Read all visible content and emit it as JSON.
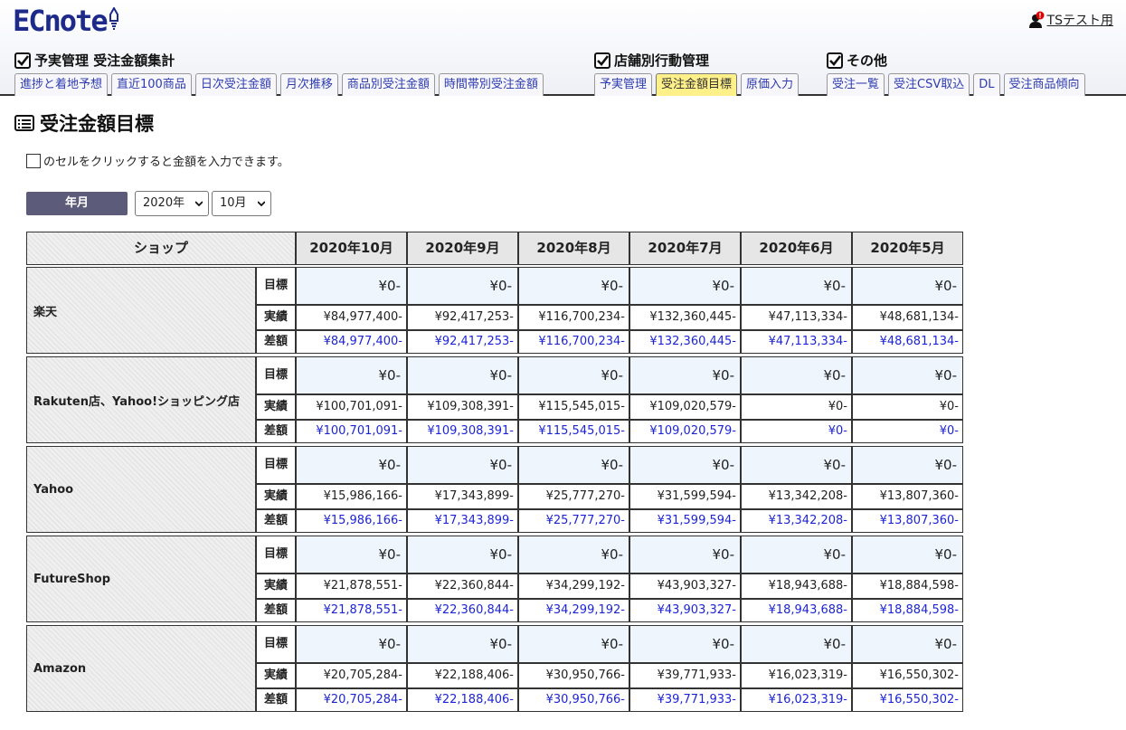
{
  "app": {
    "logo": "ECnote",
    "user": "TSテスト用"
  },
  "nav": {
    "sections": [
      {
        "title": "予実管理 受注金額集計",
        "tabs": [
          "進捗と着地予想",
          "直近100商品",
          "日次受注金額",
          "月次推移",
          "商品別受注金額",
          "時間帯別受注金額"
        ]
      },
      {
        "title": "店舗別行動管理",
        "tabs": [
          "予実管理",
          "受注金額目標",
          "原価入力"
        ],
        "active": "受注金額目標"
      },
      {
        "title": "その他",
        "tabs": [
          "受注一覧",
          "受注CSV取込",
          "DL",
          "受注商品傾向"
        ]
      }
    ]
  },
  "page": {
    "title": "受注金額目標",
    "hint": "のセルをクリックすると金額を入力できます。",
    "ym_label": "年月",
    "year_value": "2020年",
    "month_value": "10月"
  },
  "table": {
    "shop_header": "ショップ",
    "months": [
      "2020年10月",
      "2020年9月",
      "2020年8月",
      "2020年7月",
      "2020年6月",
      "2020年5月"
    ],
    "row_labels": {
      "target": "目標",
      "actual": "実績",
      "diff": "差額"
    },
    "shops": [
      {
        "name": "楽天",
        "target": [
          "¥0-",
          "¥0-",
          "¥0-",
          "¥0-",
          "¥0-",
          "¥0-"
        ],
        "actual": [
          "¥84,977,400-",
          "¥92,417,253-",
          "¥116,700,234-",
          "¥132,360,445-",
          "¥47,113,334-",
          "¥48,681,134-"
        ],
        "diff": [
          "¥84,977,400-",
          "¥92,417,253-",
          "¥116,700,234-",
          "¥132,360,445-",
          "¥47,113,334-",
          "¥48,681,134-"
        ]
      },
      {
        "name": "Rakuten店、Yahoo!ショッピング店",
        "target": [
          "¥0-",
          "¥0-",
          "¥0-",
          "¥0-",
          "¥0-",
          "¥0-"
        ],
        "actual": [
          "¥100,701,091-",
          "¥109,308,391-",
          "¥115,545,015-",
          "¥109,020,579-",
          "¥0-",
          "¥0-"
        ],
        "diff": [
          "¥100,701,091-",
          "¥109,308,391-",
          "¥115,545,015-",
          "¥109,020,579-",
          "¥0-",
          "¥0-"
        ]
      },
      {
        "name": "Yahoo",
        "target": [
          "¥0-",
          "¥0-",
          "¥0-",
          "¥0-",
          "¥0-",
          "¥0-"
        ],
        "actual": [
          "¥15,986,166-",
          "¥17,343,899-",
          "¥25,777,270-",
          "¥31,599,594-",
          "¥13,342,208-",
          "¥13,807,360-"
        ],
        "diff": [
          "¥15,986,166-",
          "¥17,343,899-",
          "¥25,777,270-",
          "¥31,599,594-",
          "¥13,342,208-",
          "¥13,807,360-"
        ]
      },
      {
        "name": "FutureShop",
        "target": [
          "¥0-",
          "¥0-",
          "¥0-",
          "¥0-",
          "¥0-",
          "¥0-"
        ],
        "actual": [
          "¥21,878,551-",
          "¥22,360,844-",
          "¥34,299,192-",
          "¥43,903,327-",
          "¥18,943,688-",
          "¥18,884,598-"
        ],
        "diff": [
          "¥21,878,551-",
          "¥22,360,844-",
          "¥34,299,192-",
          "¥43,903,327-",
          "¥18,943,688-",
          "¥18,884,598-"
        ]
      },
      {
        "name": "Amazon",
        "target": [
          "¥0-",
          "¥0-",
          "¥0-",
          "¥0-",
          "¥0-",
          "¥0-"
        ],
        "actual": [
          "¥20,705,284-",
          "¥22,188,406-",
          "¥30,950,766-",
          "¥39,771,933-",
          "¥16,023,319-",
          "¥16,550,302-"
        ],
        "diff": [
          "¥20,705,284-",
          "¥22,188,406-",
          "¥30,950,766-",
          "¥39,771,933-",
          "¥16,023,319-",
          "¥16,550,302-"
        ]
      }
    ]
  },
  "colors": {
    "brand": "#1d2a8a",
    "tab_text": "#2d3bb0",
    "active_tab": "#fff089",
    "diff_text": "#1d24d6",
    "target_bg": "#eef5fd",
    "notify": "#e00000"
  }
}
